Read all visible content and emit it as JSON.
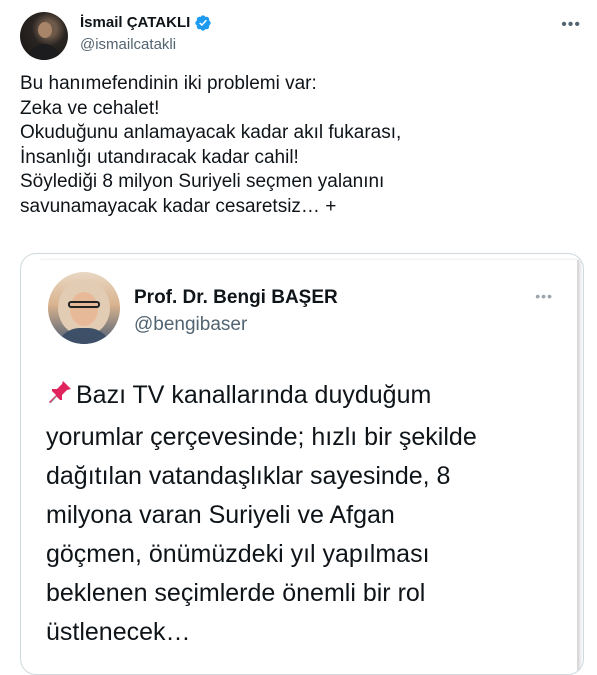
{
  "tweet": {
    "author_name": "İsmail ÇATAKLI",
    "author_handle": "@ismailcatakli",
    "more_icon": "•••",
    "text_lines": [
      "Bu hanımefendinin iki problemi var:",
      "Zeka ve cehalet!",
      "Okuduğunu anlamayacak kadar akıl fukarası,",
      "İnsanlığı utandıracak kadar cahil!",
      "Söylediği 8 milyon Suriyeli seçmen yalanını",
      "savunamayacak kadar cesaretsiz… +"
    ]
  },
  "quote": {
    "author_name": "Prof. Dr. Bengi BAŞER",
    "author_handle": "@bengibaser",
    "more_icon": "•••",
    "text_lines": [
      "Bazı TV kanallarında duyduğum",
      "yorumlar çerçevesinde; hızlı bir şekilde",
      "dağıtılan vatandaşlıklar sayesinde, 8",
      "milyona varan Suriyeli ve Afgan",
      "göçmen, önümüzdeki yıl yapılması",
      "beklenen seçimlerde önemli bir rol",
      "üstlenecek…"
    ]
  },
  "colors": {
    "text": "#0f1419",
    "secondary": "#536471",
    "verified": "#1d9bf0",
    "pin": "#e0245e",
    "border": "#cfd9de"
  },
  "icons": {
    "verified": "verified-badge-icon",
    "pin": "pushpin-emoji-icon",
    "more": "more-horizontal-icon"
  }
}
